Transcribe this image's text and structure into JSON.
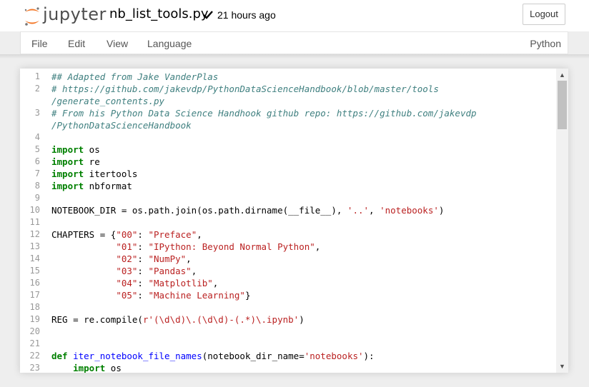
{
  "header": {
    "logo_text": "jupyter",
    "notebook_name": "nb_list_tools.py",
    "save_status": "21 hours ago",
    "logout_label": "Logout"
  },
  "menubar": {
    "items": [
      "File",
      "Edit",
      "View",
      "Language"
    ],
    "kernel": "Python"
  },
  "colors": {
    "comment": "#408080",
    "keyword": "#008000",
    "string": "#ba2121",
    "function_def": "#0000ff",
    "jupyter_orange": "#f37626"
  },
  "editor": {
    "language": "Python",
    "line_numbers": [
      "1",
      "2",
      "3",
      "4",
      "5",
      "6",
      "7",
      "8",
      "9",
      "10",
      "11",
      "12",
      "13",
      "14",
      "15",
      "16",
      "17",
      "18",
      "19",
      "20",
      "21",
      "22",
      "23"
    ],
    "lines": [
      {
        "n": "1",
        "tokens": [
          {
            "t": "## Adapted from Jake VanderPlas",
            "c": "cm"
          }
        ]
      },
      {
        "n": "2",
        "tokens": [
          {
            "t": "# https://github.com/jakevdp/PythonDataScienceHandbook/blob/master/tools",
            "c": "cm"
          }
        ]
      },
      {
        "n": "",
        "tokens": [
          {
            "t": "/generate_contents.py",
            "c": "cm"
          }
        ]
      },
      {
        "n": "3",
        "tokens": [
          {
            "t": "# From his Python Data Science Handhook github repo: https://github.com/jakevdp",
            "c": "cm"
          }
        ]
      },
      {
        "n": "",
        "tokens": [
          {
            "t": "/PythonDataScienceHandbook",
            "c": "cm"
          }
        ]
      },
      {
        "n": "4",
        "tokens": []
      },
      {
        "n": "5",
        "tokens": [
          {
            "t": "import",
            "c": "kw"
          },
          {
            "t": " os",
            "c": ""
          }
        ]
      },
      {
        "n": "6",
        "tokens": [
          {
            "t": "import",
            "c": "kw"
          },
          {
            "t": " re",
            "c": ""
          }
        ]
      },
      {
        "n": "7",
        "tokens": [
          {
            "t": "import",
            "c": "kw"
          },
          {
            "t": " itertools",
            "c": ""
          }
        ]
      },
      {
        "n": "8",
        "tokens": [
          {
            "t": "import",
            "c": "kw"
          },
          {
            "t": " nbformat",
            "c": ""
          }
        ]
      },
      {
        "n": "9",
        "tokens": []
      },
      {
        "n": "10",
        "tokens": [
          {
            "t": "NOTEBOOK_DIR = os.path.join(os.path.dirname(__file__), ",
            "c": ""
          },
          {
            "t": "'..'",
            "c": "st"
          },
          {
            "t": ", ",
            "c": ""
          },
          {
            "t": "'notebooks'",
            "c": "st"
          },
          {
            "t": ")",
            "c": ""
          }
        ]
      },
      {
        "n": "11",
        "tokens": []
      },
      {
        "n": "12",
        "tokens": [
          {
            "t": "CHAPTERS = {",
            "c": ""
          },
          {
            "t": "\"00\"",
            "c": "st"
          },
          {
            "t": ": ",
            "c": ""
          },
          {
            "t": "\"Preface\"",
            "c": "st"
          },
          {
            "t": ",",
            "c": ""
          }
        ]
      },
      {
        "n": "13",
        "tokens": [
          {
            "t": "            ",
            "c": ""
          },
          {
            "t": "\"01\"",
            "c": "st"
          },
          {
            "t": ": ",
            "c": ""
          },
          {
            "t": "\"IPython: Beyond Normal Python\"",
            "c": "st"
          },
          {
            "t": ",",
            "c": ""
          }
        ]
      },
      {
        "n": "14",
        "tokens": [
          {
            "t": "            ",
            "c": ""
          },
          {
            "t": "\"02\"",
            "c": "st"
          },
          {
            "t": ": ",
            "c": ""
          },
          {
            "t": "\"NumPy\"",
            "c": "st"
          },
          {
            "t": ",",
            "c": ""
          }
        ]
      },
      {
        "n": "15",
        "tokens": [
          {
            "t": "            ",
            "c": ""
          },
          {
            "t": "\"03\"",
            "c": "st"
          },
          {
            "t": ": ",
            "c": ""
          },
          {
            "t": "\"Pandas\"",
            "c": "st"
          },
          {
            "t": ",",
            "c": ""
          }
        ]
      },
      {
        "n": "16",
        "tokens": [
          {
            "t": "            ",
            "c": ""
          },
          {
            "t": "\"04\"",
            "c": "st"
          },
          {
            "t": ": ",
            "c": ""
          },
          {
            "t": "\"Matplotlib\"",
            "c": "st"
          },
          {
            "t": ",",
            "c": ""
          }
        ]
      },
      {
        "n": "17",
        "tokens": [
          {
            "t": "            ",
            "c": ""
          },
          {
            "t": "\"05\"",
            "c": "st"
          },
          {
            "t": ": ",
            "c": ""
          },
          {
            "t": "\"Machine Learning\"",
            "c": "st"
          },
          {
            "t": "}",
            "c": ""
          }
        ]
      },
      {
        "n": "18",
        "tokens": []
      },
      {
        "n": "19",
        "tokens": [
          {
            "t": "REG = re.compile(",
            "c": ""
          },
          {
            "t": "r'(\\d\\d)\\.(\\d\\d)-(.*)\\.ipynb'",
            "c": "st"
          },
          {
            "t": ")",
            "c": ""
          }
        ]
      },
      {
        "n": "20",
        "tokens": []
      },
      {
        "n": "21",
        "tokens": []
      },
      {
        "n": "22",
        "tokens": [
          {
            "t": "def",
            "c": "kw"
          },
          {
            "t": " ",
            "c": ""
          },
          {
            "t": "iter_notebook_file_names",
            "c": "fn"
          },
          {
            "t": "(notebook_dir_name=",
            "c": ""
          },
          {
            "t": "'notebooks'",
            "c": "st"
          },
          {
            "t": "):",
            "c": ""
          }
        ]
      },
      {
        "n": "23",
        "tokens": [
          {
            "t": "    ",
            "c": ""
          },
          {
            "t": "import",
            "c": "kw"
          },
          {
            "t": " os",
            "c": ""
          }
        ]
      }
    ]
  }
}
